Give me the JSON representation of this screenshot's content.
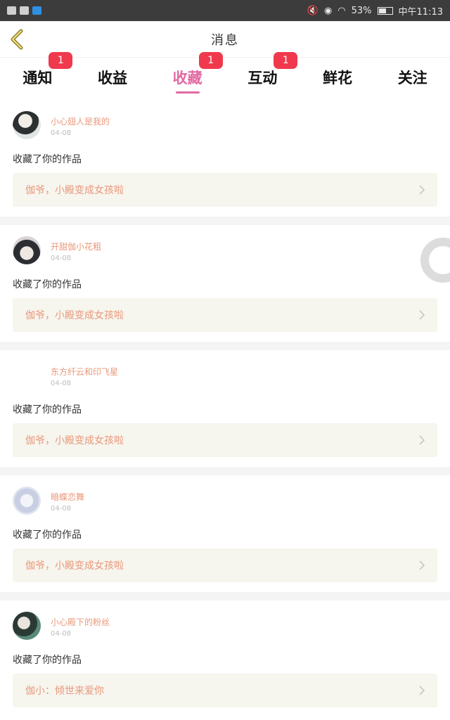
{
  "status_bar": {
    "battery": "53%",
    "time": "中午11:13"
  },
  "header": {
    "title": "消息"
  },
  "tabs": [
    {
      "label": "通知",
      "badge": "1",
      "active": false
    },
    {
      "label": "收益",
      "badge": "",
      "active": false
    },
    {
      "label": "收藏",
      "badge": "1",
      "active": true
    },
    {
      "label": "互动",
      "badge": "1",
      "active": false
    },
    {
      "label": "鲜花",
      "badge": "",
      "active": false
    },
    {
      "label": "关注",
      "badge": "",
      "active": false
    }
  ],
  "feed": [
    {
      "user": "小心翅人是我的",
      "date": "04-08",
      "action": "收藏了你的作品",
      "work": "伽爷，小殿变成女孩啦"
    },
    {
      "user": "开甜伽小花粗",
      "date": "04-08",
      "action": "收藏了你的作品",
      "work": "伽爷，小殿变成女孩啦"
    },
    {
      "user": "东方纤云和印飞星",
      "date": "04-08",
      "action": "收藏了你的作品",
      "work": "伽爷，小殿变成女孩啦"
    },
    {
      "user": "暗蝶恋舞",
      "date": "04-08",
      "action": "收藏了你的作品",
      "work": "伽爷，小殿变成女孩啦"
    },
    {
      "user": "小心殿下的粉丝",
      "date": "04-08",
      "action": "收藏了你的作品",
      "work": "伽小：倾世来爱你"
    }
  ],
  "colors": {
    "accent": "#e26aa3",
    "badge": "#f0394d",
    "username": "#e9987a"
  }
}
